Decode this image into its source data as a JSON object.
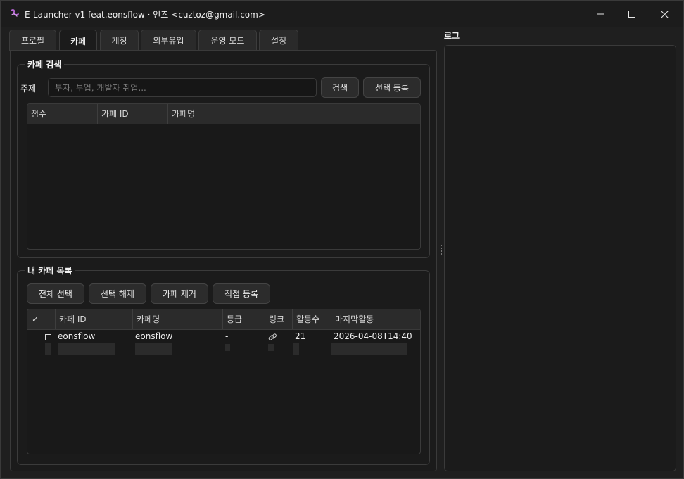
{
  "window": {
    "title": "E-Launcher v1 feat.eonsflow · 언즈 <cuztoz@gmail.com>"
  },
  "tabs": [
    {
      "label": "프로필",
      "active": false
    },
    {
      "label": "카페",
      "active": true
    },
    {
      "label": "계정",
      "active": false
    },
    {
      "label": "외부유입",
      "active": false
    },
    {
      "label": "운영 모드",
      "active": false
    },
    {
      "label": "설정",
      "active": false
    }
  ],
  "cafe_search": {
    "title": "카페 검색",
    "topic_label": "주제",
    "topic_value": "",
    "topic_placeholder": "투자, 부업, 개발자 취업...",
    "search_button": "검색",
    "register_selected_button": "선택 등록",
    "columns": [
      "점수",
      "카페 ID",
      "카페명"
    ],
    "rows": []
  },
  "my_cafes": {
    "title": "내 카페 목록",
    "select_all_button": "전체 선택",
    "deselect_button": "선택 해제",
    "remove_button": "카페 제거",
    "manual_register_button": "직접 등록",
    "columns": [
      "✓",
      "카페 ID",
      "카페명",
      "등급",
      "링크",
      "활동수",
      "마지막활동"
    ],
    "rows": [
      {
        "checked": false,
        "cafe_id": "eonsflow",
        "cafe_name": "eonsflow",
        "grade": "-",
        "link_icon": "link-icon",
        "activity_count": "21",
        "last_activity": "2026-04-08T14:40"
      }
    ]
  },
  "log": {
    "label": "로그",
    "content": ""
  },
  "colors": {
    "background": "#1f1f1f",
    "panel": "#1b1b1b",
    "button": "#2c2c2c",
    "border": "#3a3a3a",
    "accent_icon": "#b866d6"
  }
}
